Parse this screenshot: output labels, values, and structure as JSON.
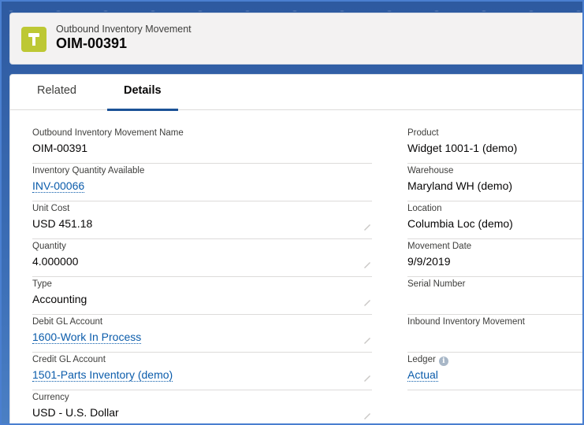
{
  "header": {
    "object_type": "Outbound Inventory Movement",
    "record_name": "OIM-00391",
    "icon": "hammer-icon",
    "icon_color": "#bdc834"
  },
  "tabs": [
    {
      "label": "Related",
      "active": false
    },
    {
      "label": "Details",
      "active": true
    }
  ],
  "left_fields": [
    {
      "label": "Outbound Inventory Movement Name",
      "value": "OIM-00391",
      "link": false,
      "editable": false
    },
    {
      "label": "Inventory Quantity Available",
      "value": "INV-00066",
      "link": true,
      "editable": false
    },
    {
      "label": "Unit Cost",
      "value": "USD 451.18",
      "link": false,
      "editable": true
    },
    {
      "label": "Quantity",
      "value": "4.000000",
      "link": false,
      "editable": true
    },
    {
      "label": "Type",
      "value": "Accounting",
      "link": false,
      "editable": true
    },
    {
      "label": "Debit GL Account",
      "value": "1600-Work In Process",
      "link": true,
      "editable": true
    },
    {
      "label": "Credit GL Account",
      "value": "1501-Parts Inventory (demo)",
      "link": true,
      "editable": true
    },
    {
      "label": "Currency",
      "value": "USD - U.S. Dollar",
      "link": false,
      "editable": true
    }
  ],
  "right_fields": [
    {
      "label": "Product",
      "value": "Widget 1001-1 (demo)",
      "link": false
    },
    {
      "label": "Warehouse",
      "value": "Maryland WH (demo)",
      "link": false
    },
    {
      "label": "Location",
      "value": "Columbia Loc (demo)",
      "link": false
    },
    {
      "label": "Movement Date",
      "value": "9/9/2019",
      "link": false
    },
    {
      "label": "Serial Number",
      "value": "",
      "link": false
    },
    {
      "label": "Inbound Inventory Movement",
      "value": "",
      "link": false
    },
    {
      "label": "Ledger",
      "value": "Actual",
      "link": true,
      "info": "i"
    }
  ],
  "colors": {
    "accent": "#1b5297",
    "link": "#0b5cab"
  }
}
